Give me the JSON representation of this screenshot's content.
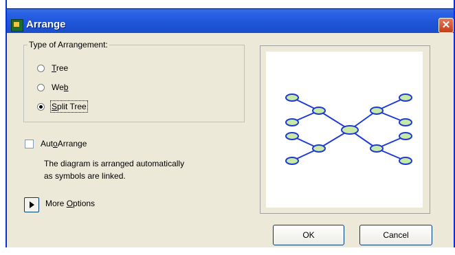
{
  "window": {
    "title": "Arrange",
    "close_glyph": "✕"
  },
  "arrangement": {
    "legend": "Type of Arrangement:",
    "options": [
      {
        "pre": "",
        "key": "T",
        "post": "ree",
        "selected": false
      },
      {
        "pre": "We",
        "key": "b",
        "post": "",
        "selected": false
      },
      {
        "pre": "",
        "key": "S",
        "post": "plit Tree",
        "selected": true
      }
    ]
  },
  "auto_arrange": {
    "pre": "Aut",
    "key": "o",
    "post": "Arrange",
    "checked": false,
    "description_line1": "The diagram is arranged automatically",
    "description_line2": "as symbols are linked."
  },
  "more_options": {
    "pre": "More ",
    "key": "O",
    "post": "ptions"
  },
  "buttons": {
    "ok": "OK",
    "cancel": "Cancel"
  },
  "preview": {
    "node_fill": "#c9eaa6",
    "node_stroke": "#1f3bd6",
    "edge_color": "#1f3bd6"
  }
}
